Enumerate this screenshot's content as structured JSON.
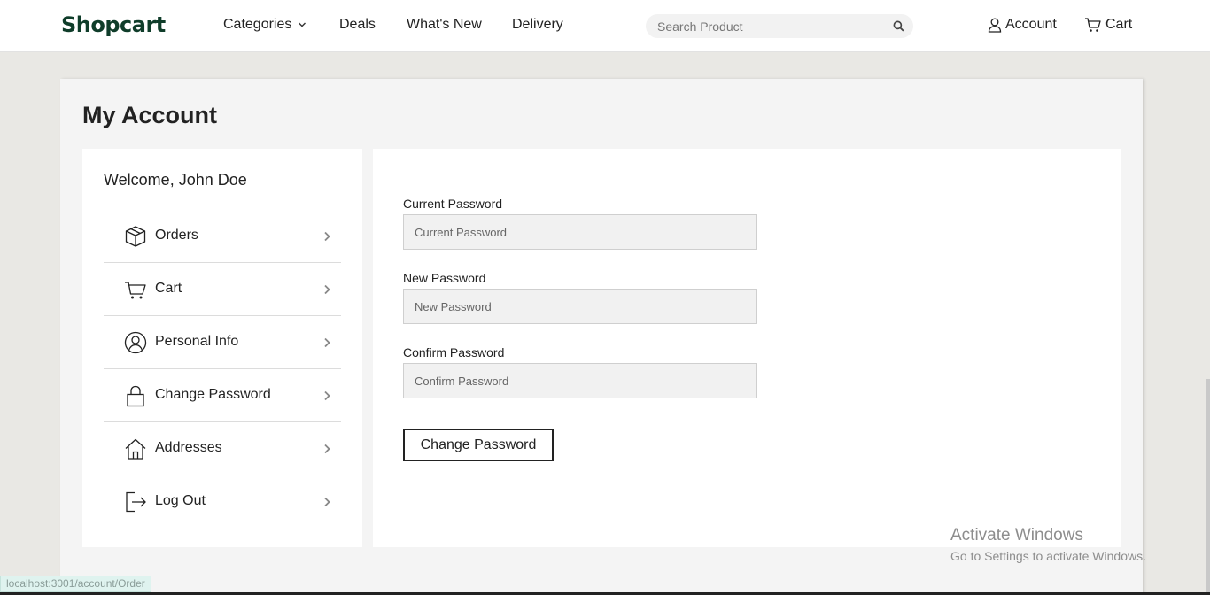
{
  "header": {
    "logo": "Shopcart",
    "nav": [
      {
        "label": "Categories"
      },
      {
        "label": "Deals"
      },
      {
        "label": "What's New"
      },
      {
        "label": "Delivery"
      }
    ],
    "search": {
      "placeholder": "Search Product",
      "icon": "search-icon"
    },
    "account_label": "Account",
    "cart_label": "Cart"
  },
  "page": {
    "title": "My Account"
  },
  "sidebar": {
    "welcome": "Welcome, John Doe",
    "items": [
      {
        "label": "Orders",
        "icon": "box-icon"
      },
      {
        "label": "Cart",
        "icon": "cart-icon"
      },
      {
        "label": "Personal Info",
        "icon": "user-circle-icon"
      },
      {
        "label": "Change Password",
        "icon": "lock-icon"
      },
      {
        "label": "Addresses",
        "icon": "home-icon"
      },
      {
        "label": "Log Out",
        "icon": "logout-icon"
      }
    ]
  },
  "form": {
    "current": {
      "label": "Current Password",
      "placeholder": "Current Password",
      "value": ""
    },
    "new": {
      "label": "New Password",
      "placeholder": "New Password",
      "value": ""
    },
    "confirm": {
      "label": "Confirm Password",
      "placeholder": "Confirm Password",
      "value": ""
    },
    "submit_label": "Change Password"
  },
  "watermark": {
    "title": "Activate Windows",
    "subtitle": "Go to Settings to activate Windows."
  },
  "status_bar": {
    "url": "localhost:3001/account/Order"
  },
  "colors": {
    "brand": "#0f3d2a",
    "page_bg": "#e9e8e4",
    "panel_bg": "#ffffff"
  }
}
